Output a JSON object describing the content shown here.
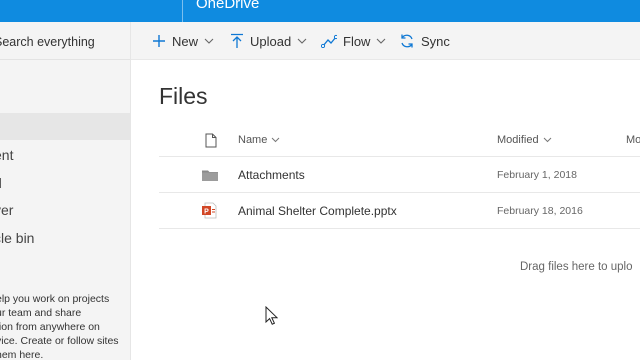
{
  "suite_bar": {
    "app_title": "OneDrive"
  },
  "search": {
    "placeholder": "Search everything"
  },
  "left_nav": {
    "items": [
      {
        "label": "ent"
      },
      {
        "label": "d"
      },
      {
        "label": "ver"
      },
      {
        "label": "cle bin"
      }
    ],
    "promo_lines": [
      "elp you work on projects",
      "ur team and share",
      "tion from anywhere on",
      "vice. Create or follow sites",
      "hem here."
    ]
  },
  "command_bar": {
    "new_label": "New",
    "upload_label": "Upload",
    "flow_label": "Flow",
    "sync_label": "Sync"
  },
  "main": {
    "title": "Files",
    "columns": {
      "name": "Name",
      "modified": "Modified",
      "more": "Mo"
    },
    "files": [
      {
        "name": "Attachments",
        "modified": "February 1, 2018",
        "type_icon": "folder-icon"
      },
      {
        "name": "Animal Shelter Complete.pptx",
        "modified": "February 18, 2016",
        "type_icon": "powerpoint-file-icon"
      }
    ],
    "drag_hint": "Drag files here to uplo"
  },
  "colors": {
    "suite_bar": "#0f8be0",
    "accent": "#0f78d4",
    "nav_background": "#f4f4f4",
    "powerpoint": "#d24726",
    "folder": "#8a8a8a"
  }
}
